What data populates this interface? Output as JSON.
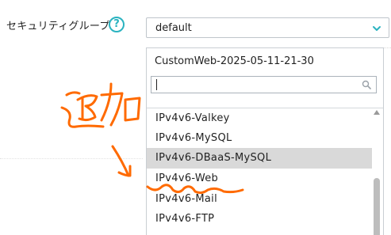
{
  "security_group": {
    "label": "セキュリティグループ",
    "help_icon": "help-circle-icon",
    "help_glyph": "?",
    "selected_value": "default",
    "chevron_icon": "chevron-down-icon"
  },
  "dropdown": {
    "header": "CustomWeb-2025-05-11-21-30",
    "search_value": "",
    "search_icon": "search-icon",
    "options": [
      {
        "label": "IPv4v6-Valkey",
        "highlighted": false
      },
      {
        "label": "IPv4v6-MySQL",
        "highlighted": false
      },
      {
        "label": "IPv4v6-DBaaS-MySQL",
        "highlighted": true
      },
      {
        "label": "IPv4v6-Web",
        "highlighted": false
      },
      {
        "label": "IPv4v6-Mail",
        "highlighted": false
      },
      {
        "label": "IPv4v6-FTP",
        "highlighted": false
      }
    ]
  },
  "colors": {
    "accent": "#2bb3c0",
    "highlight": "#d9d9d9",
    "annotation": "#ff6a00"
  }
}
